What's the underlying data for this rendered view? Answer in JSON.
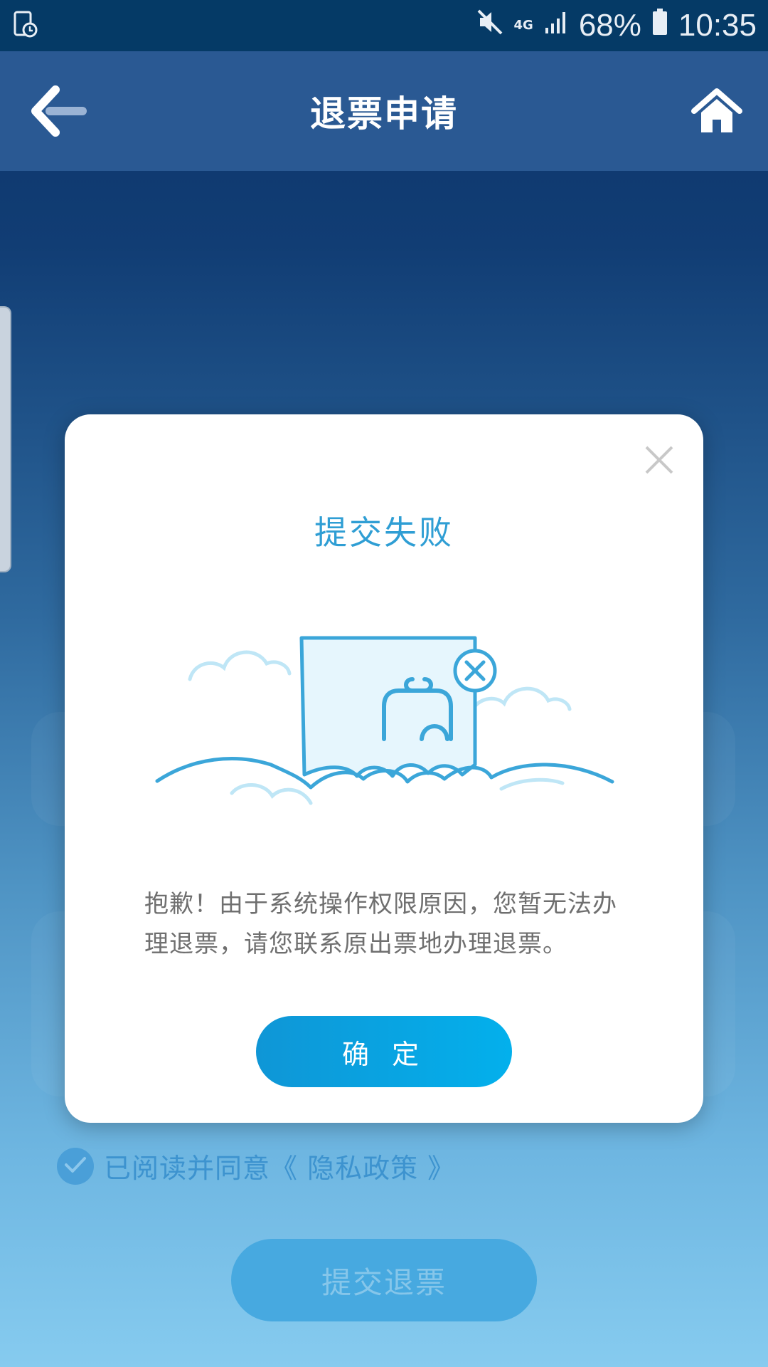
{
  "status_bar": {
    "network_type": "4G",
    "battery_percent": "68%",
    "time": "10:35",
    "icons": [
      "screen-recorder-icon",
      "mute-icon",
      "signal-icon",
      "battery-icon"
    ]
  },
  "app_bar": {
    "title": "退票申请",
    "back_icon": "back-arrow-icon",
    "home_icon": "home-icon"
  },
  "background": {
    "privacy_text": "已阅读并同意《 隐私政策 》",
    "privacy_checked": true,
    "submit_label": "提交退票"
  },
  "dialog": {
    "title": "提交失败",
    "message": "抱歉！由于系统操作权限原因，您暂无法办理退票，请您联系原出票地办理退票。",
    "confirm_label": "确 定",
    "close_icon": "close-icon",
    "illustration": "sad-ticket-on-clouds-illustration"
  },
  "colors": {
    "accent": "#2f9ed4",
    "button_start": "#0f96d6",
    "button_end": "#03b0ec",
    "app_bar": "#2a5993",
    "status_bar": "#053a66"
  }
}
